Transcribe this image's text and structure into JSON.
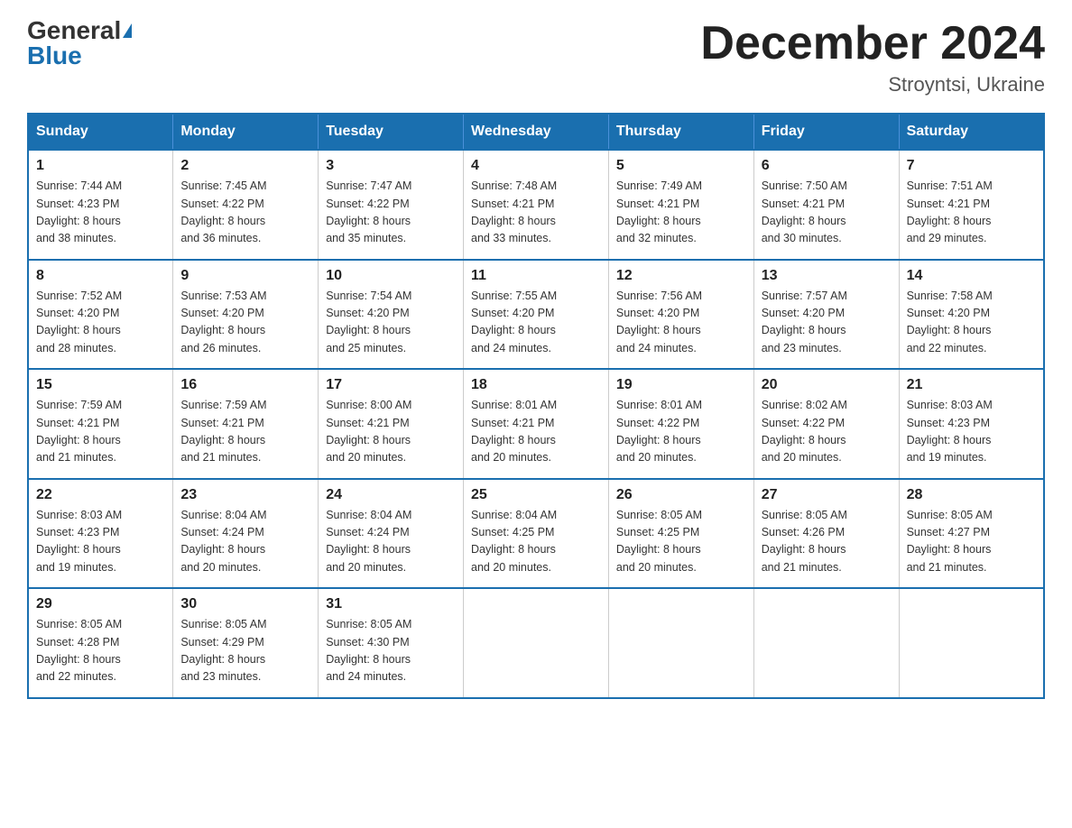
{
  "header": {
    "logo_general": "General",
    "logo_blue": "Blue",
    "title": "December 2024",
    "subtitle": "Stroyntsi, Ukraine"
  },
  "days_of_week": [
    "Sunday",
    "Monday",
    "Tuesday",
    "Wednesday",
    "Thursday",
    "Friday",
    "Saturday"
  ],
  "weeks": [
    [
      {
        "day": "1",
        "sunrise": "7:44 AM",
        "sunset": "4:23 PM",
        "daylight": "8 hours and 38 minutes."
      },
      {
        "day": "2",
        "sunrise": "7:45 AM",
        "sunset": "4:22 PM",
        "daylight": "8 hours and 36 minutes."
      },
      {
        "day": "3",
        "sunrise": "7:47 AM",
        "sunset": "4:22 PM",
        "daylight": "8 hours and 35 minutes."
      },
      {
        "day": "4",
        "sunrise": "7:48 AM",
        "sunset": "4:21 PM",
        "daylight": "8 hours and 33 minutes."
      },
      {
        "day": "5",
        "sunrise": "7:49 AM",
        "sunset": "4:21 PM",
        "daylight": "8 hours and 32 minutes."
      },
      {
        "day": "6",
        "sunrise": "7:50 AM",
        "sunset": "4:21 PM",
        "daylight": "8 hours and 30 minutes."
      },
      {
        "day": "7",
        "sunrise": "7:51 AM",
        "sunset": "4:21 PM",
        "daylight": "8 hours and 29 minutes."
      }
    ],
    [
      {
        "day": "8",
        "sunrise": "7:52 AM",
        "sunset": "4:20 PM",
        "daylight": "8 hours and 28 minutes."
      },
      {
        "day": "9",
        "sunrise": "7:53 AM",
        "sunset": "4:20 PM",
        "daylight": "8 hours and 26 minutes."
      },
      {
        "day": "10",
        "sunrise": "7:54 AM",
        "sunset": "4:20 PM",
        "daylight": "8 hours and 25 minutes."
      },
      {
        "day": "11",
        "sunrise": "7:55 AM",
        "sunset": "4:20 PM",
        "daylight": "8 hours and 24 minutes."
      },
      {
        "day": "12",
        "sunrise": "7:56 AM",
        "sunset": "4:20 PM",
        "daylight": "8 hours and 24 minutes."
      },
      {
        "day": "13",
        "sunrise": "7:57 AM",
        "sunset": "4:20 PM",
        "daylight": "8 hours and 23 minutes."
      },
      {
        "day": "14",
        "sunrise": "7:58 AM",
        "sunset": "4:20 PM",
        "daylight": "8 hours and 22 minutes."
      }
    ],
    [
      {
        "day": "15",
        "sunrise": "7:59 AM",
        "sunset": "4:21 PM",
        "daylight": "8 hours and 21 minutes."
      },
      {
        "day": "16",
        "sunrise": "7:59 AM",
        "sunset": "4:21 PM",
        "daylight": "8 hours and 21 minutes."
      },
      {
        "day": "17",
        "sunrise": "8:00 AM",
        "sunset": "4:21 PM",
        "daylight": "8 hours and 20 minutes."
      },
      {
        "day": "18",
        "sunrise": "8:01 AM",
        "sunset": "4:21 PM",
        "daylight": "8 hours and 20 minutes."
      },
      {
        "day": "19",
        "sunrise": "8:01 AM",
        "sunset": "4:22 PM",
        "daylight": "8 hours and 20 minutes."
      },
      {
        "day": "20",
        "sunrise": "8:02 AM",
        "sunset": "4:22 PM",
        "daylight": "8 hours and 20 minutes."
      },
      {
        "day": "21",
        "sunrise": "8:03 AM",
        "sunset": "4:23 PM",
        "daylight": "8 hours and 19 minutes."
      }
    ],
    [
      {
        "day": "22",
        "sunrise": "8:03 AM",
        "sunset": "4:23 PM",
        "daylight": "8 hours and 19 minutes."
      },
      {
        "day": "23",
        "sunrise": "8:04 AM",
        "sunset": "4:24 PM",
        "daylight": "8 hours and 20 minutes."
      },
      {
        "day": "24",
        "sunrise": "8:04 AM",
        "sunset": "4:24 PM",
        "daylight": "8 hours and 20 minutes."
      },
      {
        "day": "25",
        "sunrise": "8:04 AM",
        "sunset": "4:25 PM",
        "daylight": "8 hours and 20 minutes."
      },
      {
        "day": "26",
        "sunrise": "8:05 AM",
        "sunset": "4:25 PM",
        "daylight": "8 hours and 20 minutes."
      },
      {
        "day": "27",
        "sunrise": "8:05 AM",
        "sunset": "4:26 PM",
        "daylight": "8 hours and 21 minutes."
      },
      {
        "day": "28",
        "sunrise": "8:05 AM",
        "sunset": "4:27 PM",
        "daylight": "8 hours and 21 minutes."
      }
    ],
    [
      {
        "day": "29",
        "sunrise": "8:05 AM",
        "sunset": "4:28 PM",
        "daylight": "8 hours and 22 minutes."
      },
      {
        "day": "30",
        "sunrise": "8:05 AM",
        "sunset": "4:29 PM",
        "daylight": "8 hours and 23 minutes."
      },
      {
        "day": "31",
        "sunrise": "8:05 AM",
        "sunset": "4:30 PM",
        "daylight": "8 hours and 24 minutes."
      },
      null,
      null,
      null,
      null
    ]
  ],
  "labels": {
    "sunrise": "Sunrise:",
    "sunset": "Sunset:",
    "daylight": "Daylight:"
  }
}
